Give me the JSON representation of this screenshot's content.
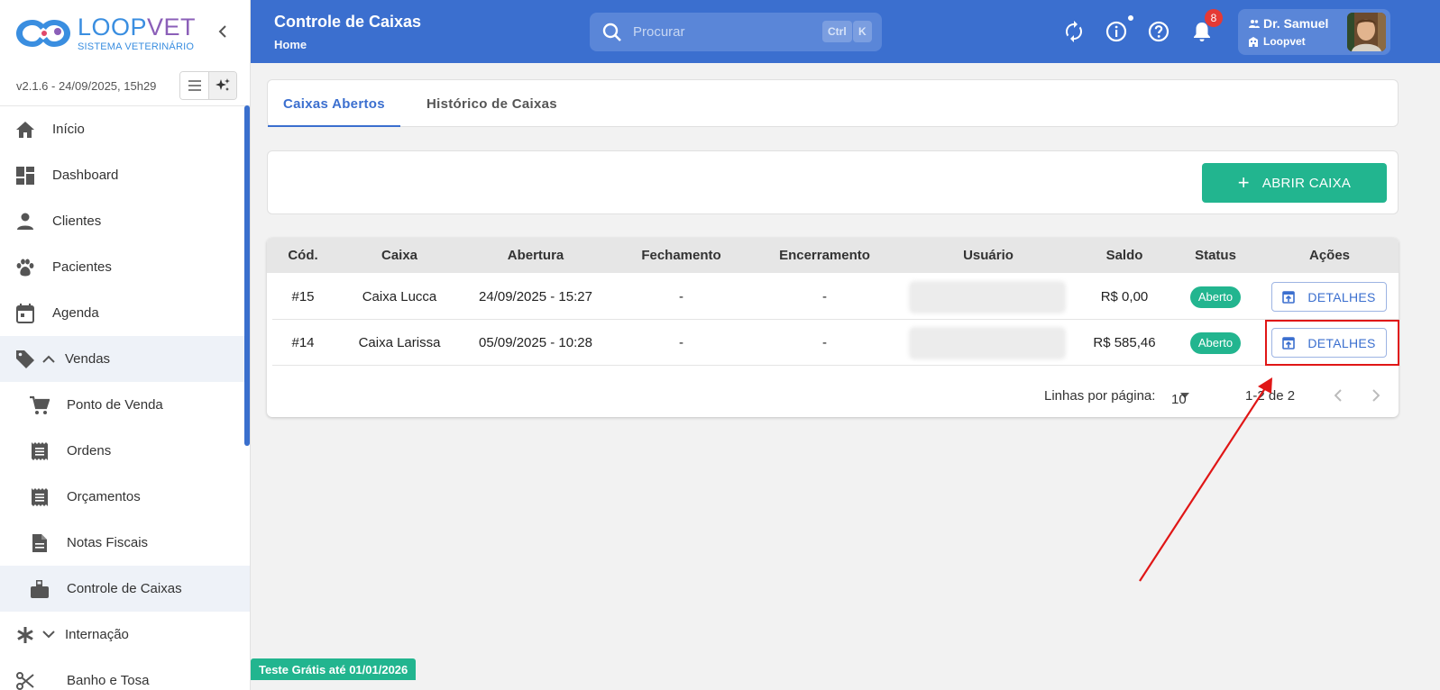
{
  "brand": {
    "name_part1": "LOOP",
    "name_part2": "VET",
    "subtitle": "SISTEMA VETERINÁRIO",
    "version": "v2.1.6 - 24/09/2025, 15h29"
  },
  "sidebar": {
    "items": [
      {
        "label": "Início",
        "icon": "home-icon"
      },
      {
        "label": "Dashboard",
        "icon": "dashboard-icon"
      },
      {
        "label": "Clientes",
        "icon": "person-icon"
      },
      {
        "label": "Pacientes",
        "icon": "paw-icon"
      },
      {
        "label": "Agenda",
        "icon": "calendar-icon"
      }
    ],
    "group_vendas": {
      "label": "Vendas",
      "icon": "tag-icon"
    },
    "sub_items": [
      {
        "label": "Ponto de Venda",
        "icon": "cart-icon"
      },
      {
        "label": "Ordens",
        "icon": "receipt-icon"
      },
      {
        "label": "Orçamentos",
        "icon": "receipt-icon"
      },
      {
        "label": "Notas Fiscais",
        "icon": "document-icon"
      },
      {
        "label": "Controle de Caixas",
        "icon": "cashbox-icon"
      }
    ],
    "group_internacao": {
      "label": "Internação",
      "icon": "asterisk-icon"
    },
    "cut_item": {
      "label": "Banho e Tosa",
      "icon": "scissors-icon"
    }
  },
  "header": {
    "title": "Controle de Caixas",
    "breadcrumb": "Home",
    "search_placeholder": "Procurar",
    "kbd_ctrl": "Ctrl",
    "kbd_k": "K",
    "notif_count": "8",
    "user_name": "Dr. Samuel",
    "user_org": "Loopvet"
  },
  "tabs": {
    "open": "Caixas Abertos",
    "history": "Histórico de Caixas"
  },
  "actions": {
    "open_cash": "ABRIR CAIXA"
  },
  "table": {
    "columns": [
      "Cód.",
      "Caixa",
      "Abertura",
      "Fechamento",
      "Encerramento",
      "Usuário",
      "Saldo",
      "Status",
      "Ações"
    ],
    "rows": [
      {
        "code": "#15",
        "box": "Caixa Lucca",
        "opened": "24/09/2025 - 15:27",
        "closed": "-",
        "ended": "-",
        "balance": "R$ 0,00",
        "status": "Aberto",
        "action": "DETALHES"
      },
      {
        "code": "#14",
        "box": "Caixa Larissa",
        "opened": "05/09/2025 - 10:28",
        "closed": "-",
        "ended": "-",
        "balance": "R$ 585,46",
        "status": "Aberto",
        "action": "DETALHES"
      }
    ],
    "rows_per_page_label": "Linhas por página:",
    "rows_per_page": "10",
    "range": "1-2 de 2"
  },
  "trial": "Teste Grátis até 01/01/2026",
  "colors": {
    "primary": "#3b6fcf",
    "accent_green": "#22b58f",
    "highlight_red": "#e01616"
  }
}
